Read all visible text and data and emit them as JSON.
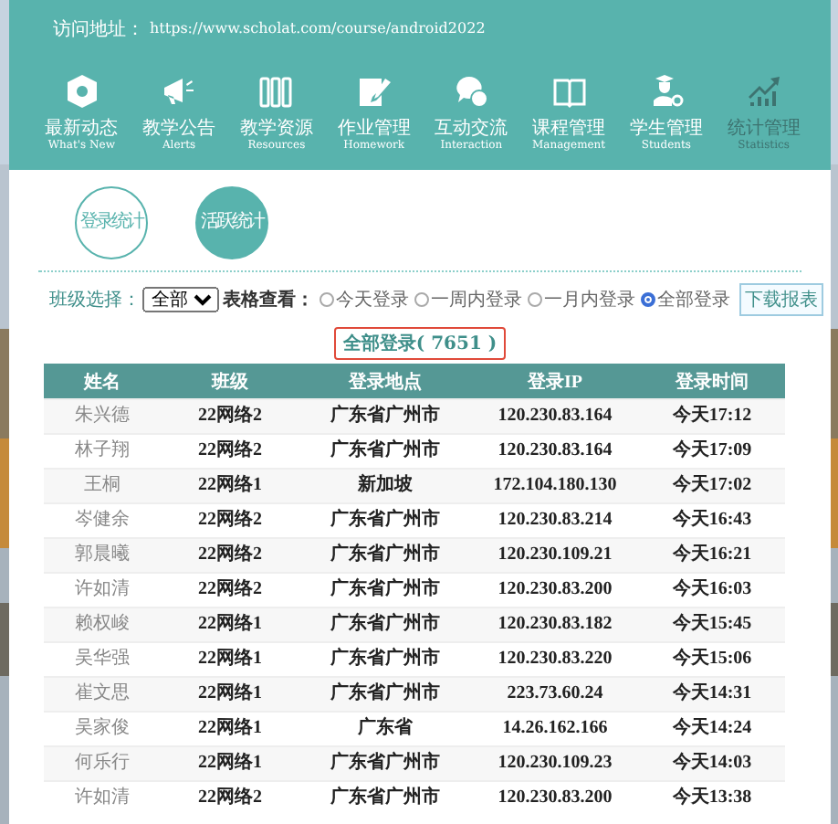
{
  "header": {
    "url_label": "访问地址：",
    "url": "https://www.scholat.com/course/android2022"
  },
  "nav": [
    {
      "label": "最新动态",
      "sublabel": "What's New",
      "selected": false
    },
    {
      "label": "教学公告",
      "sublabel": "Alerts",
      "selected": false
    },
    {
      "label": "教学资源",
      "sublabel": "Resources",
      "selected": false
    },
    {
      "label": "作业管理",
      "sublabel": "Homework",
      "selected": false
    },
    {
      "label": "互动交流",
      "sublabel": "Interaction",
      "selected": false
    },
    {
      "label": "课程管理",
      "sublabel": "Management",
      "selected": false
    },
    {
      "label": "学生管理",
      "sublabel": "Students",
      "selected": false
    },
    {
      "label": "统计管理",
      "sublabel": "Statistics",
      "selected": true
    }
  ],
  "stat_tabs": [
    {
      "label": "登录统计",
      "selected": false
    },
    {
      "label": "活跃统计",
      "selected": true
    }
  ],
  "filters": {
    "class_label": "班级选择：",
    "class_value": "全部",
    "view_label": "表格查看：",
    "views": [
      {
        "label": "今天登录",
        "selected": false
      },
      {
        "label": "一周内登录",
        "selected": false
      },
      {
        "label": "一月内登录",
        "selected": false
      },
      {
        "label": "全部登录",
        "selected": true
      }
    ],
    "download": "下载报表"
  },
  "table": {
    "title": "全部登录( 7651 )",
    "columns": [
      "姓名",
      "班级",
      "登录地点",
      "登录IP",
      "登录时间"
    ],
    "rows": [
      [
        "朱兴德",
        "22网络2",
        "广东省广州市",
        "120.230.83.164",
        "今天17:12"
      ],
      [
        "林子翔",
        "22网络2",
        "广东省广州市",
        "120.230.83.164",
        "今天17:09"
      ],
      [
        "王桐",
        "22网络1",
        "新加坡",
        "172.104.180.130",
        "今天17:02"
      ],
      [
        "岑健余",
        "22网络2",
        "广东省广州市",
        "120.230.83.214",
        "今天16:43"
      ],
      [
        "郭晨曦",
        "22网络2",
        "广东省广州市",
        "120.230.109.21",
        "今天16:21"
      ],
      [
        "许如清",
        "22网络2",
        "广东省广州市",
        "120.230.83.200",
        "今天16:03"
      ],
      [
        "赖权峻",
        "22网络1",
        "广东省广州市",
        "120.230.83.182",
        "今天15:45"
      ],
      [
        "吴华强",
        "22网络1",
        "广东省广州市",
        "120.230.83.220",
        "今天15:06"
      ],
      [
        "崔文思",
        "22网络1",
        "广东省广州市",
        "223.73.60.24",
        "今天14:31"
      ],
      [
        "吴家俊",
        "22网络1",
        "广东省",
        "14.26.162.166",
        "今天14:24"
      ],
      [
        "何乐行",
        "22网络1",
        "广东省广州市",
        "120.230.109.23",
        "今天14:03"
      ],
      [
        "许如清",
        "22网络2",
        "广东省广州市",
        "120.230.83.200",
        "今天13:38"
      ]
    ]
  }
}
